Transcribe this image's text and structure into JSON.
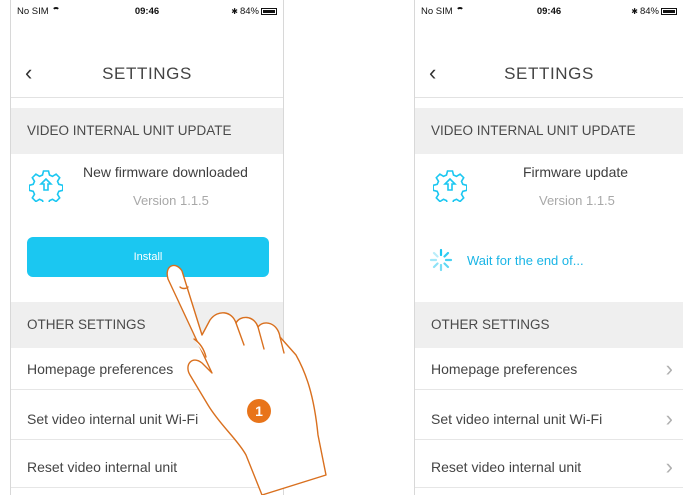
{
  "status_bar": {
    "carrier": "No SIM",
    "time": "09:46",
    "battery": "84%"
  },
  "screen_left": {
    "title": "SETTINGS",
    "section_update": "VIDEO INTERNAL UNIT UPDATE",
    "update_title": "New firmware downloaded",
    "update_version": "Version 1.1.5",
    "install_label": "Install",
    "section_other": "OTHER SETTINGS",
    "rows": [
      "Homepage preferences",
      "Set video internal unit Wi-Fi",
      "Reset video internal unit"
    ]
  },
  "screen_right": {
    "title": "SETTINGS",
    "section_update": "VIDEO INTERNAL UNIT UPDATE",
    "update_title": "Firmware update",
    "update_version": "Version 1.1.5",
    "wait_text": "Wait for the end of...",
    "section_other": "OTHER SETTINGS",
    "rows": [
      "Homepage preferences",
      "Set video internal unit Wi-Fi",
      "Reset video internal unit"
    ]
  },
  "step_badge": "1",
  "colors": {
    "accent": "#1bc7f1",
    "step": "#e8741a",
    "hand_outline": "#d9701f"
  },
  "icons": [
    "back-chevron-icon",
    "firmware-gear-icon",
    "spinner-icon",
    "chevron-right-icon",
    "wifi-icon",
    "battery-icon",
    "bluetooth-icon"
  ]
}
